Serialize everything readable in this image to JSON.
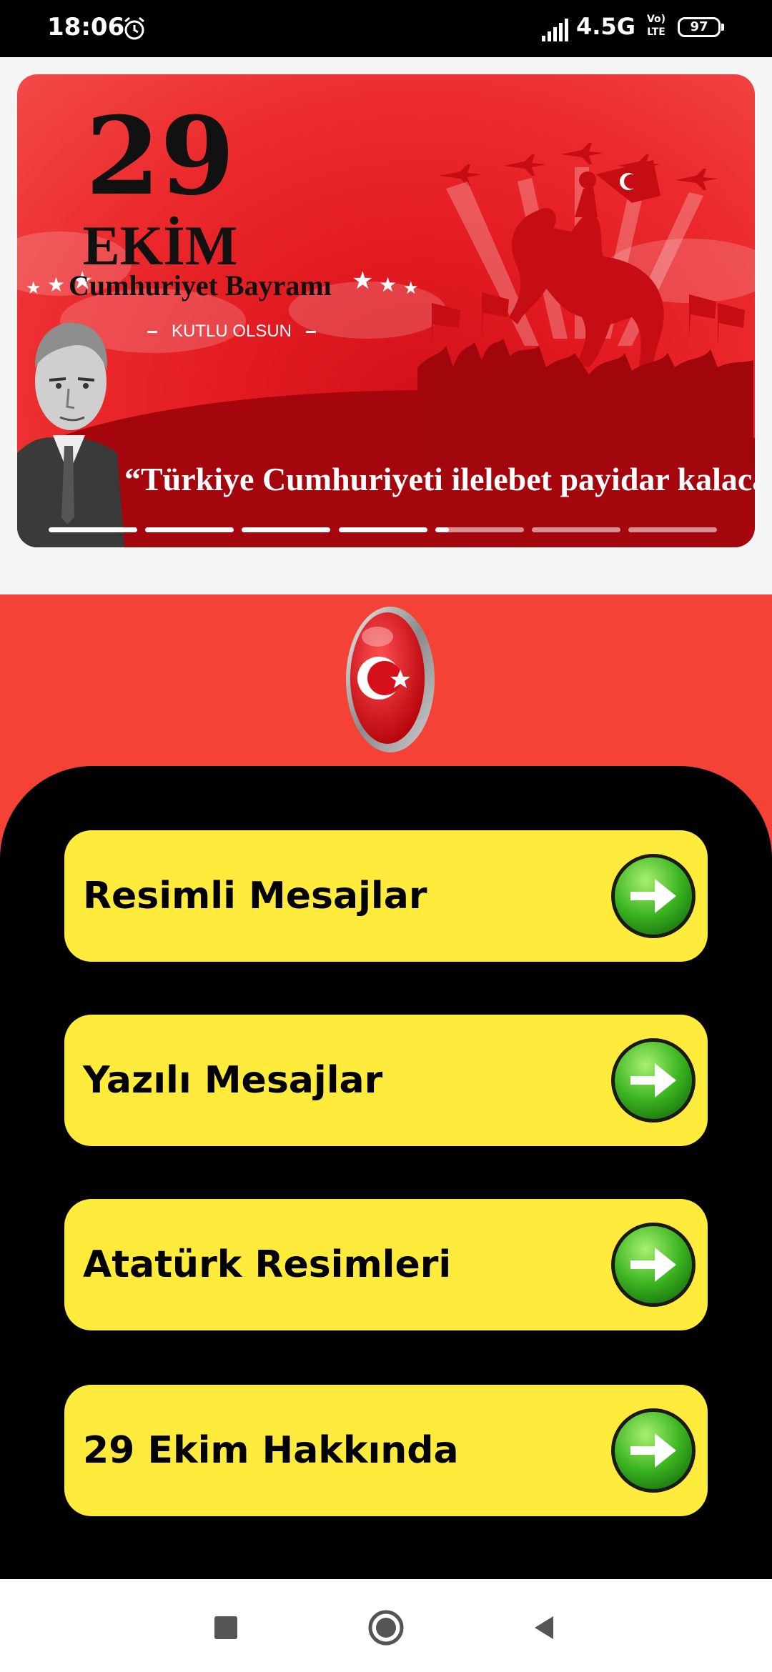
{
  "status_bar": {
    "time": "18:06",
    "network": "4.5G",
    "volte_line1": "Vo)",
    "volte_line2": "LTE",
    "battery": "97",
    "icons": [
      "alarm-icon",
      "signal-icon",
      "volte-icon",
      "battery-icon"
    ]
  },
  "banner": {
    "day": "29",
    "month": "EKİM",
    "title": "Cumhuriyet Bayramı",
    "subtitle": "KUTLU OLSUN",
    "quote": "“Türkiye Cumhuriyeti ilelebet payidar kalacaktır”",
    "page_count": 7,
    "current_page_progress": 0.15
  },
  "menu": {
    "items": [
      {
        "label": "Resimli Mesajlar",
        "icon": "arrow-right-icon"
      },
      {
        "label": "Yazılı Mesajlar",
        "icon": "arrow-right-icon"
      },
      {
        "label": "Atatürk Resimleri",
        "icon": "arrow-right-icon"
      },
      {
        "label": "29 Ekim Hakkında",
        "icon": "arrow-right-icon"
      }
    ]
  },
  "colors": {
    "status_bar": "#000000",
    "red_section": "#f44336",
    "panel": "#000000",
    "button": "#ffeb3b",
    "arrow_green": "#3cb521"
  },
  "nav_bar": {
    "icons": [
      "recent-apps-icon",
      "home-icon",
      "back-icon"
    ]
  }
}
